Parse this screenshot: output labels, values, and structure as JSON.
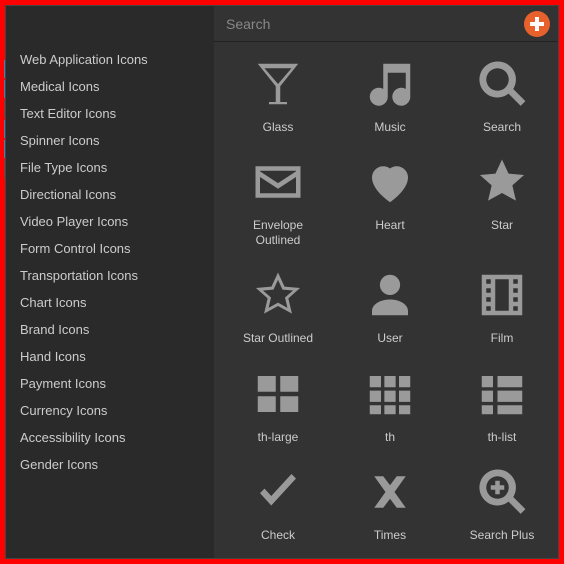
{
  "search": {
    "placeholder": "Search"
  },
  "add_button": {
    "name": "add-icon"
  },
  "sidebar": {
    "items": [
      {
        "label": "Web Application Icons"
      },
      {
        "label": "Medical Icons"
      },
      {
        "label": "Text Editor Icons"
      },
      {
        "label": "Spinner Icons"
      },
      {
        "label": "File Type Icons"
      },
      {
        "label": "Directional Icons"
      },
      {
        "label": "Video Player Icons"
      },
      {
        "label": "Form Control Icons"
      },
      {
        "label": "Transportation Icons"
      },
      {
        "label": "Chart Icons"
      },
      {
        "label": "Brand Icons"
      },
      {
        "label": "Hand Icons"
      },
      {
        "label": "Payment Icons"
      },
      {
        "label": "Currency Icons"
      },
      {
        "label": "Accessibility Icons"
      },
      {
        "label": "Gender Icons"
      }
    ]
  },
  "icons": [
    {
      "label": "Glass",
      "glyph": "glass-icon"
    },
    {
      "label": "Music",
      "glyph": "music-icon"
    },
    {
      "label": "Search",
      "glyph": "search-icon"
    },
    {
      "label": "Envelope Outlined",
      "glyph": "envelope-outlined-icon"
    },
    {
      "label": "Heart",
      "glyph": "heart-icon"
    },
    {
      "label": "Star",
      "glyph": "star-icon"
    },
    {
      "label": "Star Outlined",
      "glyph": "star-outlined-icon"
    },
    {
      "label": "User",
      "glyph": "user-icon"
    },
    {
      "label": "Film",
      "glyph": "film-icon"
    },
    {
      "label": "th-large",
      "glyph": "th-large-icon"
    },
    {
      "label": "th",
      "glyph": "th-icon"
    },
    {
      "label": "th-list",
      "glyph": "th-list-icon"
    },
    {
      "label": "Check",
      "glyph": "check-icon"
    },
    {
      "label": "Times",
      "glyph": "times-icon"
    },
    {
      "label": "Search Plus",
      "glyph": "search-plus-icon"
    }
  ],
  "colors": {
    "bg_outer": "#ff0000",
    "bg_panel": "#2a2a2a",
    "bg_main": "#333333",
    "icon_fill": "#9a9a9a",
    "text": "#cccccc",
    "accent": "#e8612c"
  }
}
